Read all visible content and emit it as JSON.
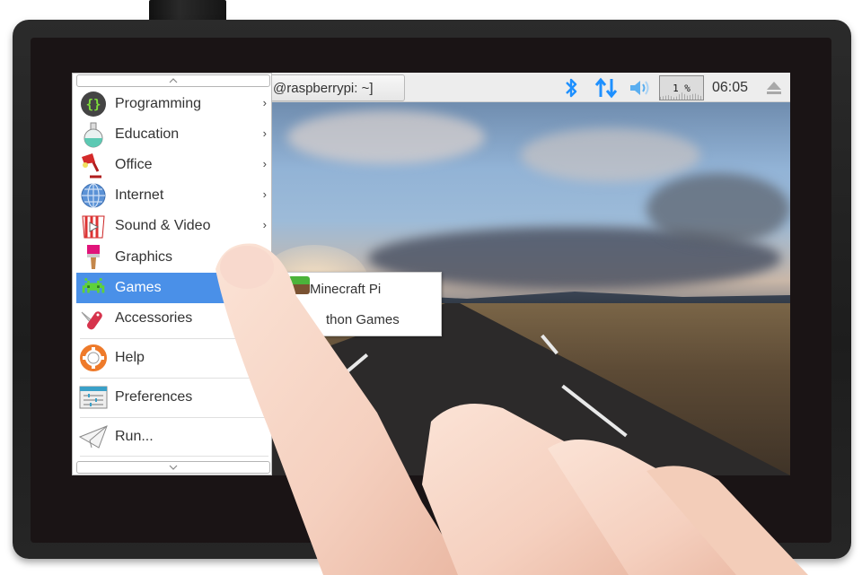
{
  "device": {
    "type": "tablet-display",
    "bezel_color": "#222222"
  },
  "panel": {
    "task_button_label": "@raspberrypi: ~]",
    "tray": {
      "bluetooth_icon": "bluetooth-icon",
      "network_icon": "network-updown-icon",
      "volume_icon": "volume-icon",
      "cpu_usage": "1 %",
      "clock": "06:05",
      "eject_icon": "eject-icon"
    },
    "accent_color": "#1e90ff"
  },
  "menu": {
    "scroll_up_glyph": "^",
    "scroll_down_glyph": "v",
    "items": [
      {
        "label": "Programming",
        "icon": "programming-icon",
        "has_submenu": true
      },
      {
        "label": "Education",
        "icon": "education-flask-icon",
        "has_submenu": true
      },
      {
        "label": "Office",
        "icon": "office-lamp-icon",
        "has_submenu": true
      },
      {
        "label": "Internet",
        "icon": "internet-globe-icon",
        "has_submenu": true
      },
      {
        "label": "Sound & Video",
        "icon": "sound-video-icon",
        "has_submenu": true
      },
      {
        "label": "Graphics",
        "icon": "graphics-brush-icon",
        "has_submenu": true
      },
      {
        "label": "Games",
        "icon": "games-invader-icon",
        "has_submenu": true,
        "active": true
      },
      {
        "label": "Accessories",
        "icon": "accessories-knife-icon",
        "has_submenu": true
      },
      {
        "label": "Help",
        "icon": "help-lifebuoy-icon",
        "has_submenu": false
      },
      {
        "label": "Preferences",
        "icon": "preferences-icon",
        "has_submenu": true
      },
      {
        "label": "Run...",
        "icon": "run-paperplane-icon",
        "has_submenu": false
      }
    ],
    "arrow_glyph": "›",
    "active_color": "#4a90e8"
  },
  "submenu": {
    "items": [
      {
        "label": "Minecraft Pi",
        "icon": "minecraft-icon"
      },
      {
        "label": "thon Games",
        "icon": "python-games-icon"
      }
    ]
  }
}
